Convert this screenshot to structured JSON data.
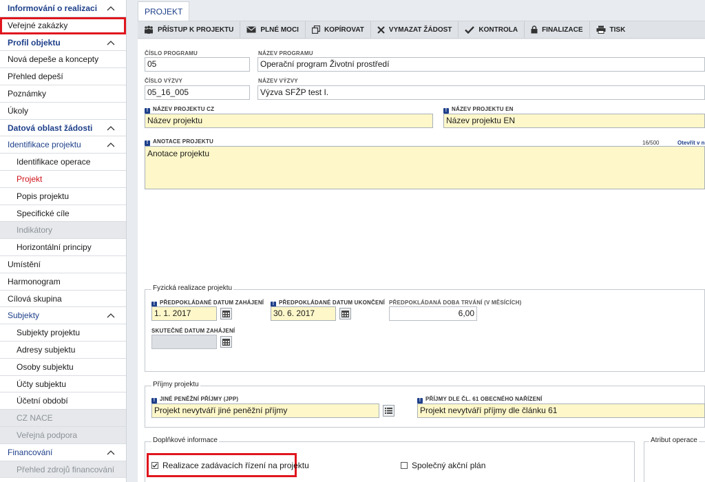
{
  "sidebar": {
    "items": [
      {
        "label": "Informování o realizaci",
        "type": "head"
      },
      {
        "label": "Veřejné zakázky",
        "type": "item"
      },
      {
        "label": "Profil objektu",
        "type": "head"
      },
      {
        "label": "Nová depeše a koncepty",
        "type": "item"
      },
      {
        "label": "Přehled depeší",
        "type": "item"
      },
      {
        "label": "Poznámky",
        "type": "item"
      },
      {
        "label": "Úkoly",
        "type": "item"
      },
      {
        "label": "Datová oblast žádosti",
        "type": "head"
      },
      {
        "label": "Identifikace projektu",
        "type": "section"
      },
      {
        "label": "Identifikace operace",
        "type": "sub"
      },
      {
        "label": "Projekt",
        "type": "sub"
      },
      {
        "label": "Popis projektu",
        "type": "sub"
      },
      {
        "label": "Specifické cíle",
        "type": "sub"
      },
      {
        "label": "Indikátory",
        "type": "sub"
      },
      {
        "label": "Horizontální principy",
        "type": "sub"
      },
      {
        "label": "Umístění",
        "type": "item"
      },
      {
        "label": "Harmonogram",
        "type": "item"
      },
      {
        "label": "Cílová skupina",
        "type": "item"
      },
      {
        "label": "Subjekty",
        "type": "section"
      },
      {
        "label": "Subjekty projektu",
        "type": "sub"
      },
      {
        "label": "Adresy subjektu",
        "type": "sub"
      },
      {
        "label": "Osoby subjektu",
        "type": "sub"
      },
      {
        "label": "Účty subjektu",
        "type": "sub"
      },
      {
        "label": "Účetní období",
        "type": "sub"
      },
      {
        "label": "CZ NACE",
        "type": "sub"
      },
      {
        "label": "Veřejná podpora",
        "type": "sub"
      },
      {
        "label": "Financování",
        "type": "section"
      },
      {
        "label": "Přehled zdrojů financování",
        "type": "sub"
      }
    ]
  },
  "tab": {
    "label": "PROJEKT"
  },
  "toolbar": {
    "buttons": [
      {
        "label": "PŘÍSTUP K PROJEKTU",
        "icon": "users-icon"
      },
      {
        "label": "PLNÉ MOCI",
        "icon": "envelope-icon"
      },
      {
        "label": "KOPÍROVAT",
        "icon": "copy-icon"
      },
      {
        "label": "VYMAZAT ŽÁDOST",
        "icon": "x-icon"
      },
      {
        "label": "KONTROLA",
        "icon": "check-icon"
      },
      {
        "label": "FINALIZACE",
        "icon": "lock-icon"
      },
      {
        "label": "TISK",
        "icon": "printer-icon"
      }
    ]
  },
  "form": {
    "cislo_programu": {
      "label": "ČÍSLO PROGRAMU",
      "value": "05"
    },
    "nazev_programu": {
      "label": "NÁZEV PROGRAMU",
      "value": "Operační program Životní prostředí"
    },
    "cislo_vyzvy": {
      "label": "ČÍSLO VÝZVY",
      "value": "05_16_005"
    },
    "nazev_vyzvy": {
      "label": "NÁZEV VÝZVY",
      "value": "Výzva SFŽP test I."
    },
    "nazev_projektu_cz": {
      "label": "NÁZEV PROJEKTU CZ",
      "value": "Název projektu"
    },
    "nazev_projektu_en": {
      "label": "NÁZEV PROJEKTU EN",
      "value": "Název projektu EN"
    },
    "anotace": {
      "label": "ANOTACE PROJEKTU",
      "value": "Anotace projektu",
      "counter": "16/500",
      "open_link": "Otevřít v n"
    },
    "fyzicka_realizace": {
      "legend": "Fyzická realizace projektu",
      "datum_zahajeni": {
        "label": "PŘEDPOKLÁDANÉ DATUM ZAHÁJENÍ",
        "value": "1. 1. 2017"
      },
      "datum_ukonceni": {
        "label": "PŘEDPOKLÁDANÉ DATUM UKONČENÍ",
        "value": "30. 6. 2017"
      },
      "doba_trvani": {
        "label": "PŘEDPOKLÁDANÁ DOBA TRVÁNÍ (V MĚSÍCÍCH)",
        "value": "6,00"
      },
      "skutecne_datum": {
        "label": "SKUTEČNÉ DATUM ZAHÁJENÍ",
        "value": ""
      }
    },
    "prijmy": {
      "legend": "Příjmy projektu",
      "jine_prijmy": {
        "label": "JINÉ PENĚŽNÍ PŘÍJMY (JPP)",
        "value": "Projekt nevytváří jiné peněžní příjmy"
      },
      "prijmy_cl61": {
        "label": "PŘÍJMY DLE ČL. 61 OBECNÉHO NAŘÍZENÍ",
        "value": "Projekt nevytváří příjmy dle článku 61"
      }
    },
    "doplnkove": {
      "legend": "Doplňkové informace",
      "realizace_zr": {
        "label": "Realizace zadávacích řízení na projektu",
        "checked": true
      },
      "spolecny_plan": {
        "label": "Společný akční plán",
        "checked": false
      }
    },
    "atribut": {
      "legend": "Atribut operace"
    }
  },
  "colors": {
    "accent": "#1d3f8a",
    "active": "#d0141b",
    "highlight": "#e0151d",
    "required_bg": "#fdf7c9"
  }
}
